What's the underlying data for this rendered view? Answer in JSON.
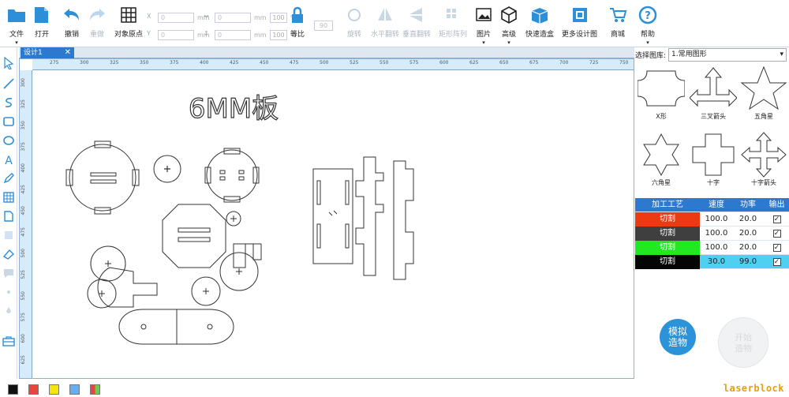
{
  "toolbar": {
    "file": "文件",
    "open": "打开",
    "undo": "撤销",
    "redo": "重做",
    "object_origin": "对象原点",
    "x_value": "0",
    "y_value": "0",
    "w_value": "0",
    "h_value": "0",
    "unit": "mm",
    "pct_w": "100",
    "pct_h": "100",
    "pct_sign": "%",
    "proportional": "等比",
    "rotation_value": "90",
    "rotate": "旋转",
    "hflip": "水平翻转",
    "vflip": "垂直翻转",
    "rect_array": "矩形阵列",
    "image": "图片",
    "advanced": "高级",
    "quick_box": "快速造盒",
    "more_designs": "更多设计图",
    "mall": "商城",
    "help": "帮助"
  },
  "tab": {
    "label": "设计1",
    "close": "✕"
  },
  "ruler": {
    "h_labels": [
      "275",
      "300",
      "325",
      "350",
      "375",
      "400",
      "425",
      "450",
      "475",
      "500",
      "525",
      "550",
      "575",
      "600",
      "625",
      "650",
      "675",
      "700",
      "725",
      "750"
    ],
    "v_labels": [
      "300",
      "325",
      "350",
      "375",
      "400",
      "425",
      "450",
      "475",
      "500",
      "525",
      "550",
      "575",
      "600",
      "625"
    ]
  },
  "design": {
    "title": "6MM板"
  },
  "library": {
    "label": "选择图库:",
    "selected": "1.常用图形",
    "shapes": [
      "X形",
      "三叉箭头",
      "五角星",
      "六角星",
      "十字",
      "十字箭头"
    ]
  },
  "process_table": {
    "headers": [
      "加工工艺",
      "速度",
      "功率",
      "输出"
    ],
    "rows": [
      {
        "mode": "切割",
        "color": "#ee3a12",
        "text_color": "#ffffff",
        "speed": "100.0",
        "power": "20.0",
        "output": "✓"
      },
      {
        "mode": "切割",
        "color": "#3f3f3f",
        "text_color": "#ffffff",
        "speed": "100.0",
        "power": "20.0",
        "output": "✓"
      },
      {
        "mode": "切割",
        "color": "#22e822",
        "text_color": "#ffffff",
        "speed": "100.0",
        "power": "20.0",
        "output": "✓"
      },
      {
        "mode": "切割",
        "color": "#050505",
        "text_color": "#ffffff",
        "speed": "30.0",
        "power": "99.0",
        "output": "✓",
        "selected": true
      }
    ]
  },
  "buttons": {
    "simulate_l1": "模拟",
    "simulate_l2": "造物",
    "start_l1": "开始",
    "start_l2": "造物"
  },
  "palette": [
    "#111111",
    "#e8463c",
    "#f5e40f",
    "#67aef0",
    "multi"
  ],
  "brand": "laserblock"
}
